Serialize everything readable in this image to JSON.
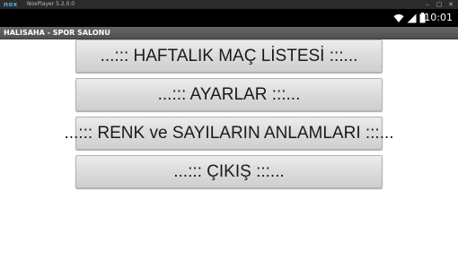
{
  "emulator": {
    "logo": "nox",
    "title": "NoxPlayer 5.2.0.0",
    "controls": [
      "minimize-icon",
      "maximize-icon",
      "close-icon"
    ]
  },
  "statusbar": {
    "icons": [
      "wifi-icon",
      "signal-icon",
      "battery-icon"
    ],
    "time": "10:01"
  },
  "app": {
    "title": "HALISAHA - SPOR SALONU"
  },
  "menu": {
    "items": [
      {
        "label": "...:::  HAFTALIK MAÇ LİSTESİ :::..."
      },
      {
        "label": "...:::  AYARLAR :::..."
      },
      {
        "label": "...::: RENK ve SAYILARIN ANLAMLARI :::..."
      },
      {
        "label": "...::: ÇIKIŞ :::..."
      }
    ]
  },
  "colors": {
    "statusbar": "#000000",
    "actionbar": "#5c5c5c",
    "button_face": "#dcdcdc",
    "background": "#ffffff"
  }
}
